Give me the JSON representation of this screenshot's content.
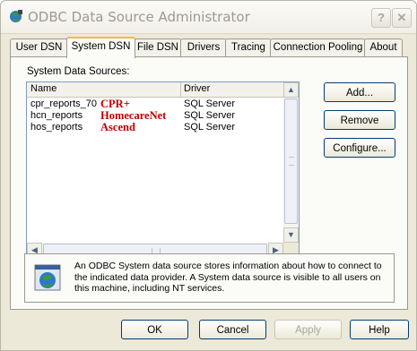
{
  "window": {
    "title": "ODBC Data Source Administrator"
  },
  "titlebar": {
    "help_label": "?",
    "close_label": "✕"
  },
  "tabs": [
    {
      "label": "User DSN"
    },
    {
      "label": "System DSN"
    },
    {
      "label": "File DSN"
    },
    {
      "label": "Drivers"
    },
    {
      "label": "Tracing"
    },
    {
      "label": "Connection Pooling"
    },
    {
      "label": "About"
    }
  ],
  "panel": {
    "group_label": "System Data Sources:",
    "columns": {
      "name": "Name",
      "driver": "Driver"
    },
    "rows": [
      {
        "name": "cpr_reports_70",
        "annotation": "CPR+",
        "driver": "SQL Server"
      },
      {
        "name": "hcn_reports",
        "annotation": "HomecareNet",
        "driver": "SQL Server"
      },
      {
        "name": "hos_reports",
        "annotation": "Ascend",
        "driver": "SQL Server"
      }
    ],
    "scroll": {
      "up": "▲",
      "down": "▼",
      "left": "◀",
      "right": "▶"
    },
    "buttons": {
      "add": "Add...",
      "remove": "Remove",
      "configure": "Configure..."
    },
    "info_text": "An ODBC System data source stores information about how to connect to the indicated data provider.   A System data source is visible to all users on this machine, including NT services."
  },
  "footer": {
    "ok": "OK",
    "cancel": "Cancel",
    "apply": "Apply",
    "help": "Help"
  },
  "colors": {
    "annotation": "#c00000",
    "active_tab_accent": "#f2b942"
  }
}
